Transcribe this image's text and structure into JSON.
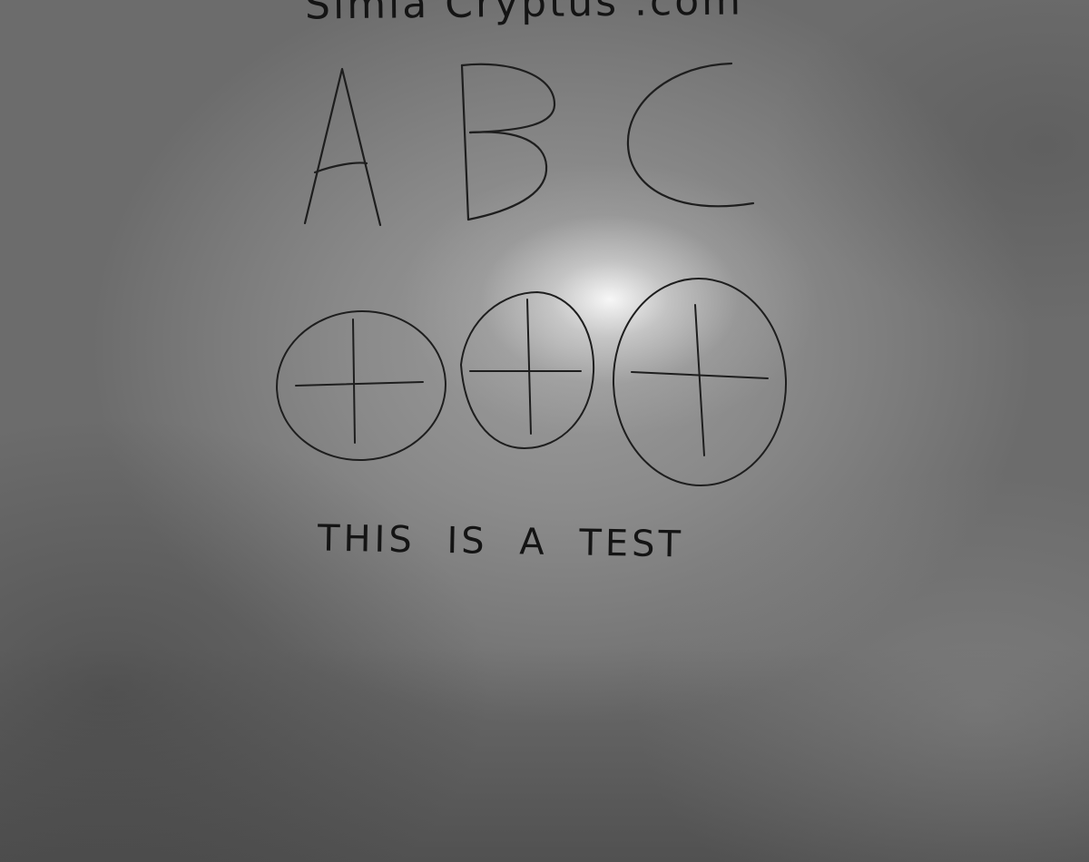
{
  "photo": {
    "subject": "handwritten test sheet",
    "header_text": "Simia Cryptus .com",
    "letters": [
      "A",
      "B",
      "C"
    ],
    "circled_crosses": [
      {
        "name": "cross-circle-left"
      },
      {
        "name": "cross-circle-middle"
      },
      {
        "name": "cross-circle-right"
      }
    ],
    "caption": "THIS IS A TEST",
    "colors": {
      "ink": "#1e1e1e",
      "paper": "#8a8a8a",
      "glare": "#f2f2f2"
    }
  }
}
